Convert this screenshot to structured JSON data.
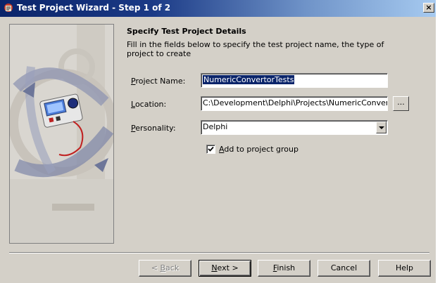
{
  "window": {
    "title": "Test Project Wizard - Step 1 of 2",
    "close_label": "×"
  },
  "content": {
    "heading": "Specify Test Project Details",
    "description": "Fill in the fields below to specify the test project name, the type of project to create"
  },
  "form": {
    "project_name": {
      "label_mnemonic": "P",
      "label_rest": "roject Name:",
      "value": "NumericConvertorTests"
    },
    "location": {
      "label_mnemonic": "L",
      "label_rest": "ocation:",
      "value": "C:\\Development\\Delphi\\Projects\\NumericConvertor\\Te",
      "browse_label": "..."
    },
    "personality": {
      "label_mnemonic": "P",
      "label_rest": "ersonality:",
      "value": "Delphi"
    },
    "add_to_group": {
      "label_mnemonic": "A",
      "label_rest": "dd to project group",
      "checked": true
    }
  },
  "buttons": {
    "back": {
      "prefix": "< ",
      "mnemonic": "B",
      "rest": "ack"
    },
    "next": {
      "mnemonic": "N",
      "rest": "ext >"
    },
    "finish": {
      "mnemonic": "F",
      "rest": "inish"
    },
    "cancel": "Cancel",
    "help": "Help"
  },
  "icons": {
    "app": "wizard-app-icon",
    "illustration": "test-device-illustration"
  }
}
